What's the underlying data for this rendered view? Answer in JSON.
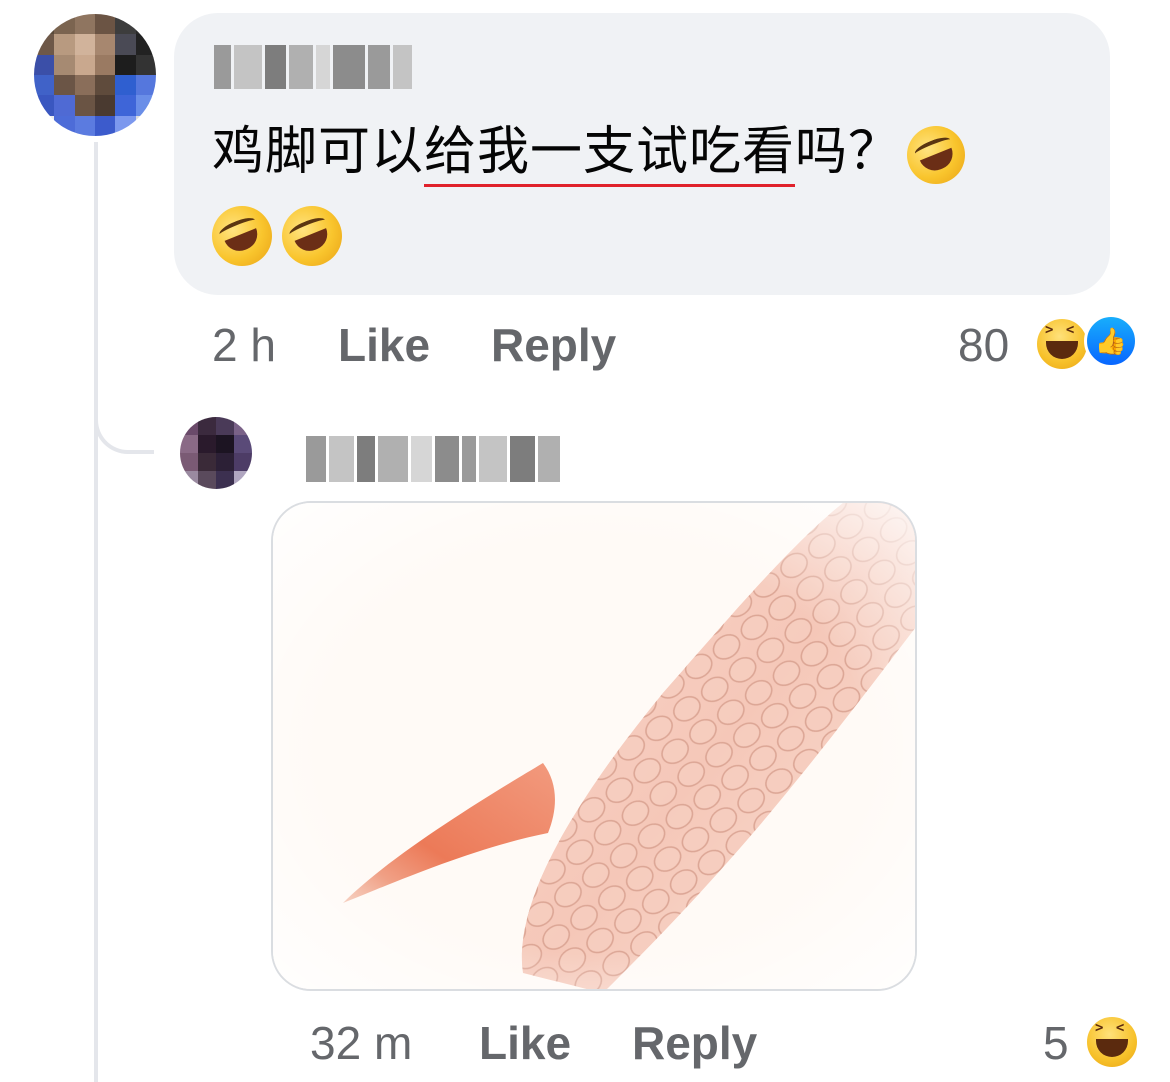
{
  "comment": {
    "text_before": "鸡脚可以",
    "text_underlined": "给我一支试吃看",
    "text_after": "吗？",
    "emojis": [
      "rolling-on-floor-laughing",
      "rolling-on-floor-laughing",
      "rolling-on-floor-laughing"
    ],
    "time": "2 h",
    "like_label": "Like",
    "reply_label": "Reply",
    "reaction_count": "80",
    "reactions": [
      "haha",
      "like"
    ]
  },
  "reply": {
    "attachment": "chicken-feet-photo",
    "time": "32 m",
    "like_label": "Like",
    "reply_label": "Reply",
    "reaction_count": "5",
    "reactions": [
      "haha"
    ]
  },
  "colors": {
    "bubble": "#f0f2f5",
    "meta_text": "#65676b",
    "like_blue": "#0866ff",
    "spellcheck_underline": "#e0212b"
  }
}
